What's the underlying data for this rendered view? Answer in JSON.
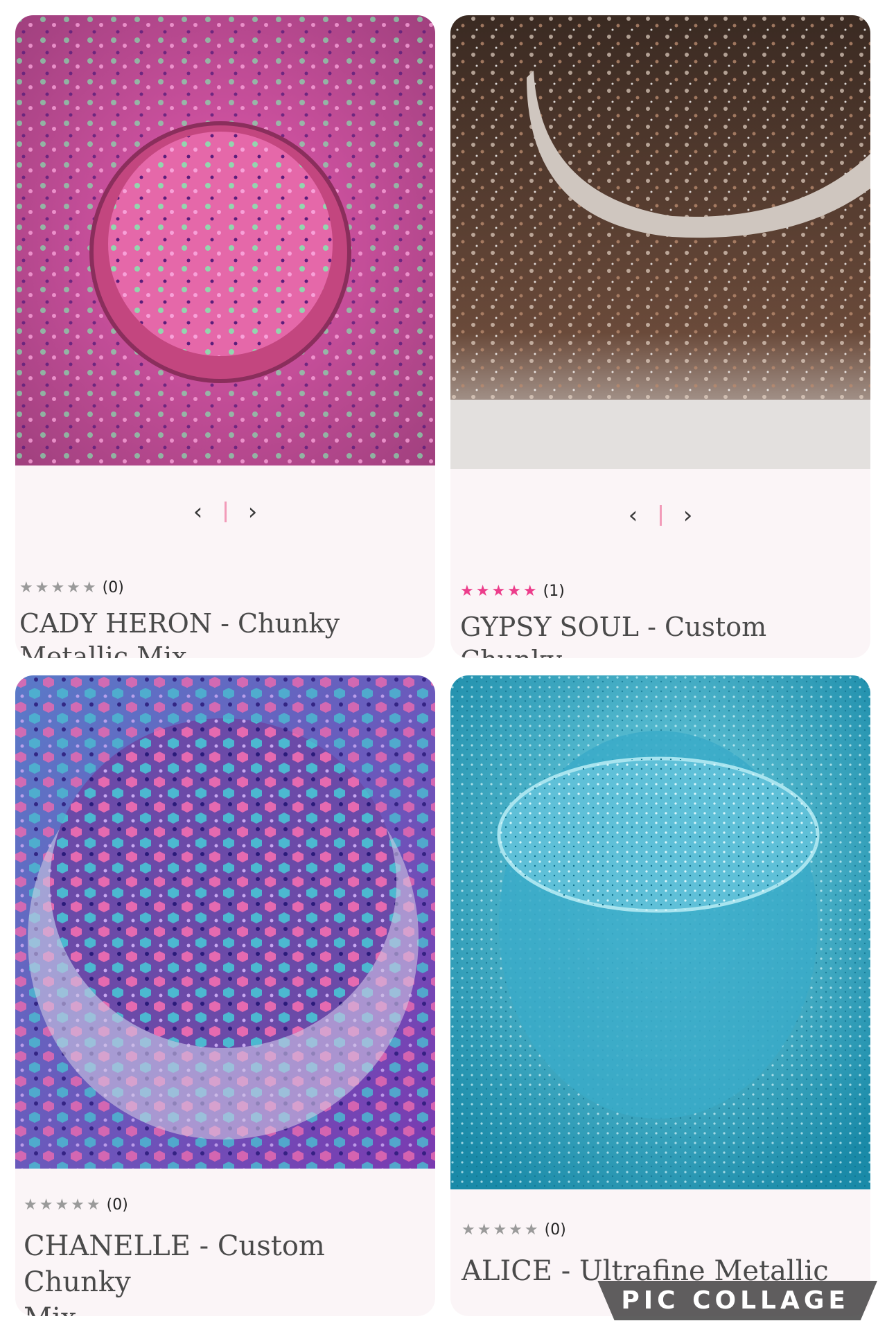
{
  "products": [
    {
      "title": "CADY HERON - Chunky\nMetallic Mix",
      "rating": {
        "stars": "★★★★★",
        "count": "(0)",
        "filled": 0
      },
      "pager": {
        "prev": "‹",
        "next": "›"
      }
    },
    {
      "title": "GYPSY SOUL - Custom Chunky\nHolographic Mix",
      "rating": {
        "stars": "★★★★★",
        "count": "(1)",
        "filled": 5
      },
      "pager": {
        "prev": "‹",
        "next": "›"
      }
    },
    {
      "title": "CHANELLE - Custom Chunky\nMix",
      "rating": {
        "stars": "★★★★★",
        "count": "(0)",
        "filled": 0
      }
    },
    {
      "title": "ALICE - Ultrafine Metallic",
      "rating": {
        "stars": "★★★★★",
        "count": "(0)",
        "filled": 0
      }
    }
  ],
  "watermark": "PIC COLLAGE",
  "colors": {
    "star_active": "#ec3d8b",
    "star_inactive": "#9a9a9a",
    "card_bg": "#fbf5f7"
  }
}
